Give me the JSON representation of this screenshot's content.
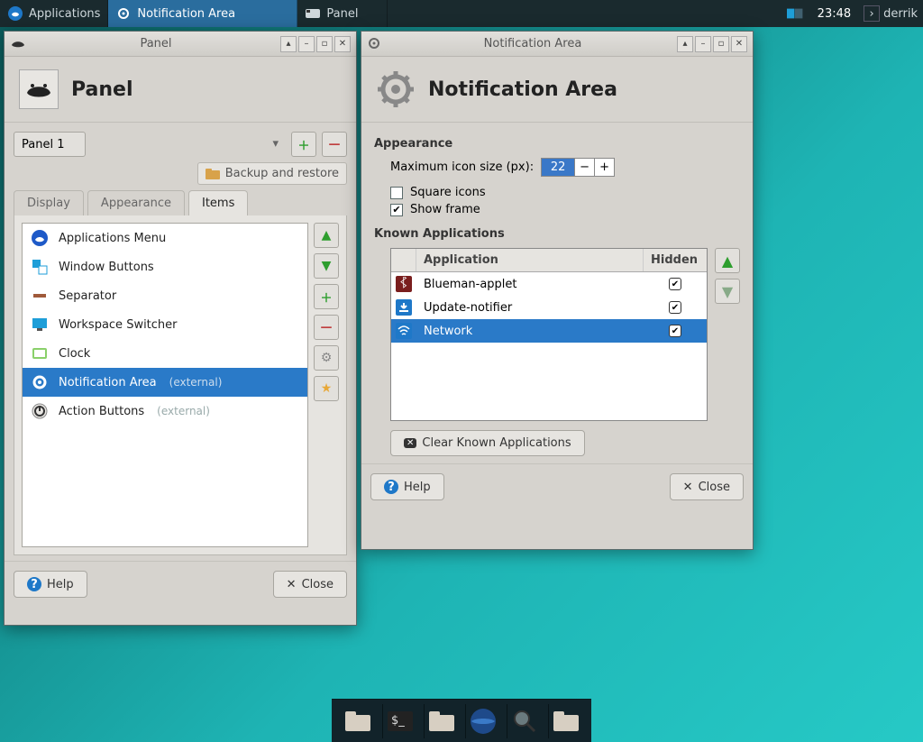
{
  "taskbar": {
    "apps_label": "Applications",
    "tasks": [
      {
        "label": "Notification Area",
        "icon": "gear-icon",
        "active": true
      },
      {
        "label": "Panel",
        "icon": "panel-icon",
        "active": false
      }
    ],
    "clock": "23:48",
    "user": "derrik"
  },
  "panel_window": {
    "title": "Panel",
    "header": "Panel",
    "combo_value": "Panel 1",
    "backup_label": "Backup and restore",
    "tabs": [
      "Display",
      "Appearance",
      "Items"
    ],
    "active_tab": 2,
    "items": [
      {
        "label": "Applications Menu",
        "icon": "apps-menu-icon",
        "sel": false,
        "ext": ""
      },
      {
        "label": "Window Buttons",
        "icon": "window-buttons-icon",
        "sel": false,
        "ext": ""
      },
      {
        "label": "Separator",
        "icon": "separator-icon",
        "sel": false,
        "ext": ""
      },
      {
        "label": "Workspace Switcher",
        "icon": "workspace-icon",
        "sel": false,
        "ext": ""
      },
      {
        "label": "Clock",
        "icon": "clock-icon",
        "sel": false,
        "ext": ""
      },
      {
        "label": "Notification Area",
        "icon": "gear-icon",
        "sel": true,
        "ext": "(external)"
      },
      {
        "label": "Action Buttons",
        "icon": "power-icon",
        "sel": false,
        "ext": "(external)"
      }
    ],
    "help_label": "Help",
    "close_label": "Close"
  },
  "notif_window": {
    "title": "Notification Area",
    "header": "Notification Area",
    "appearance_label": "Appearance",
    "max_icon_label": "Maximum icon size (px):",
    "max_icon_value": "22",
    "square_label": "Square icons",
    "square_checked": false,
    "frame_label": "Show frame",
    "frame_checked": true,
    "known_label": "Known Applications",
    "col_app": "Application",
    "col_hidden": "Hidden",
    "apps": [
      {
        "name": "Blueman-applet",
        "icon": "bt-icon",
        "hidden": true,
        "sel": false,
        "icon_bg": "#7a1e1e",
        "icon_fg": "#fff"
      },
      {
        "name": "Update-notifier",
        "icon": "download-icon",
        "hidden": true,
        "sel": false,
        "icon_bg": "#1e78c8",
        "icon_fg": "#fff"
      },
      {
        "name": "Network",
        "icon": "wifi-icon",
        "hidden": true,
        "sel": true,
        "icon_bg": "#1e78c8",
        "icon_fg": "#fff"
      }
    ],
    "clear_label": "Clear Known Applications",
    "help_label": "Help",
    "close_label": "Close"
  },
  "dock": {
    "items": [
      "files-icon",
      "terminal-icon",
      "files-icon",
      "web-icon",
      "search-icon",
      "files-icon"
    ]
  }
}
